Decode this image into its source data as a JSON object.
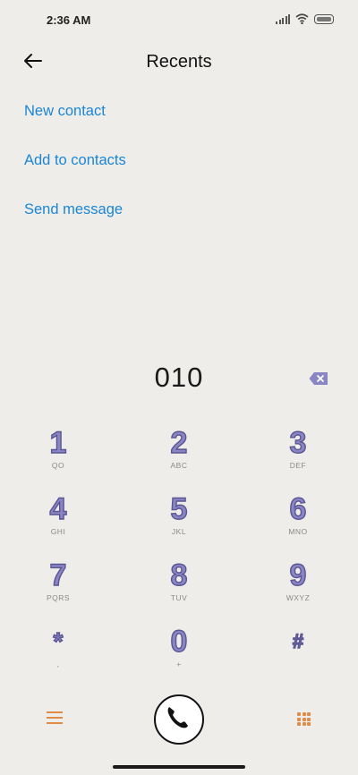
{
  "status_bar": {
    "time": "2:36 AM"
  },
  "header": {
    "title": "Recents"
  },
  "actions": {
    "new_contact": "New contact",
    "add_to_contacts": "Add to contacts",
    "send_message": "Send message"
  },
  "dialer": {
    "number": "010"
  },
  "keypad": [
    {
      "digit": "1",
      "sub": "QO"
    },
    {
      "digit": "2",
      "sub": "ABC"
    },
    {
      "digit": "3",
      "sub": "DEF"
    },
    {
      "digit": "4",
      "sub": "GHI"
    },
    {
      "digit": "5",
      "sub": "JKL"
    },
    {
      "digit": "6",
      "sub": "MNO"
    },
    {
      "digit": "7",
      "sub": "PQRS"
    },
    {
      "digit": "8",
      "sub": "TUV"
    },
    {
      "digit": "9",
      "sub": "WXYZ"
    },
    {
      "digit": "*",
      "sub": ","
    },
    {
      "digit": "0",
      "sub": "+"
    },
    {
      "digit": "#",
      "sub": ""
    }
  ],
  "colors": {
    "accent_link": "#1a86d4",
    "key_digit": "#8a86c4",
    "bottom_icons": "#e08c48",
    "background": "#efedea"
  },
  "icons": {
    "back": "arrow-left-icon",
    "backspace": "backspace-icon",
    "menu": "menu-icon",
    "call": "phone-icon",
    "dialpad": "dialpad-icon"
  }
}
